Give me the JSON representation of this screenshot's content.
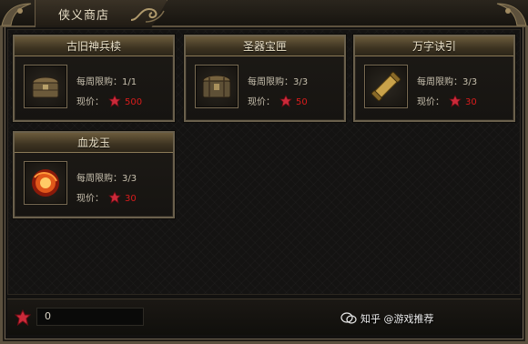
{
  "shop": {
    "title": "侠义商店"
  },
  "items": [
    {
      "name": "古旧神兵椟",
      "limit_label": "每周限购：",
      "limit_value": "1/1",
      "price_label": "现价：",
      "price": "500",
      "icon": "chest-icon"
    },
    {
      "name": "圣器宝匣",
      "limit_label": "每周限购：",
      "limit_value": "3/3",
      "price_label": "现价：",
      "price": "50",
      "icon": "treasure-box-icon"
    },
    {
      "name": "万字诀引",
      "limit_label": "每周限购：",
      "limit_value": "3/3",
      "price_label": "现价：",
      "price": "30",
      "icon": "scroll-icon"
    },
    {
      "name": "血龙玉",
      "limit_label": "每周限购：",
      "limit_value": "3/3",
      "price_label": "现价：",
      "price": "30",
      "icon": "jade-orb-icon"
    }
  ],
  "currency": {
    "icon": "red-gem-icon",
    "value": "0"
  },
  "watermark": {
    "text": "知乎 @游戏推荐"
  },
  "colors": {
    "price": "#d81c1c",
    "gem": "#cc2a3a",
    "border": "#6a604c",
    "header": "#6b5b3c"
  }
}
